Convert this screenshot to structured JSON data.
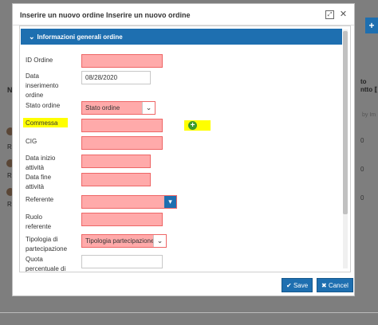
{
  "modal": {
    "title": "Inserire un nuovo ordine Inserire un nuovo ordine",
    "panel_title": "Informazioni generali ordine",
    "icons": [
      "expand-icon",
      "close-icon"
    ]
  },
  "form": {
    "id_ordine": {
      "label": "ID Ordine",
      "value": ""
    },
    "data_inserimento": {
      "label": "Data inserimento ordine",
      "value": "08/28/2020"
    },
    "stato_ordine": {
      "label": "Stato ordine",
      "value": "Stato ordine"
    },
    "commessa": {
      "label": "Commessa",
      "value": ""
    },
    "cig": {
      "label": "CIG",
      "value": ""
    },
    "data_inizio": {
      "label": "Data inizio attività",
      "value": ""
    },
    "data_fine": {
      "label": "Data fine attività",
      "value": ""
    },
    "referente": {
      "label": "Referente",
      "value": ""
    },
    "ruolo_referente": {
      "label": "Ruolo referente",
      "value": ""
    },
    "tipologia": {
      "label": "Tipologia di partecipazione",
      "value": "Tipologia partecipazione"
    },
    "quota": {
      "label": "Quota percentuale di RTI",
      "value": ""
    }
  },
  "buttons": {
    "save": "Save",
    "cancel": "Cancel"
  },
  "background": {
    "add_button": "+",
    "col_header_n": "N",
    "col_header_right": "to\nntto ⟦",
    "col_filter": "by Im",
    "row_text": "Ro",
    "row_right": "0"
  },
  "colors": {
    "accent": "#1e6fb0",
    "required_field": "#ffaaaa",
    "highlight": "#ffff00",
    "add": "#3c9a2c"
  }
}
